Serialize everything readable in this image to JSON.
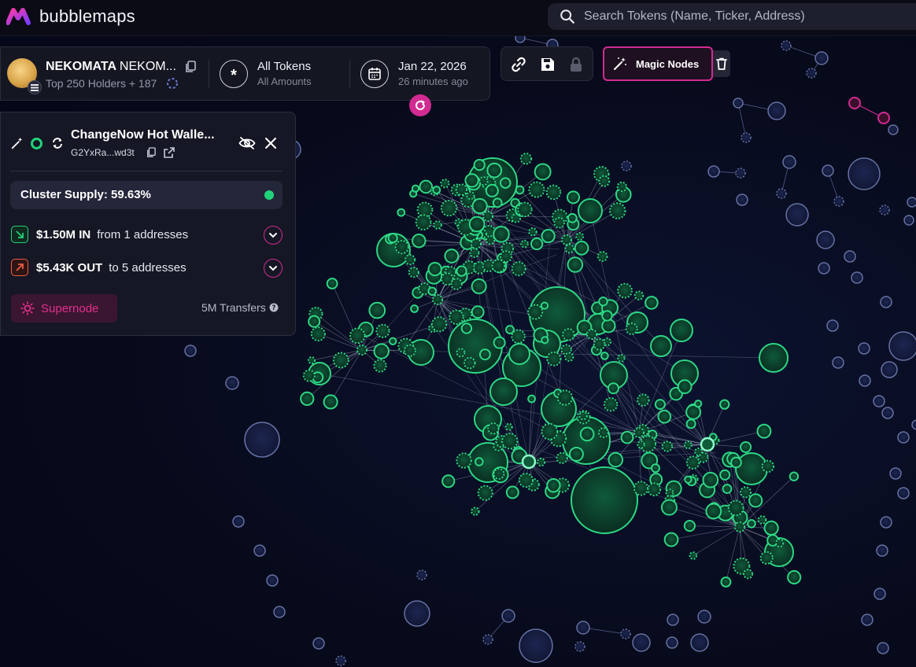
{
  "app": {
    "name": "bubblemaps"
  },
  "search": {
    "placeholder": "Search Tokens (Name, Ticker, Address)"
  },
  "token": {
    "name": "NEKOMATA",
    "ticker": "NEKOM...",
    "holders_label": "Top 250 Holders + 187"
  },
  "filter": {
    "title": "All Tokens",
    "subtitle": "All Amounts"
  },
  "date": {
    "title": "Jan 22, 2026",
    "subtitle": "26 minutes ago"
  },
  "toolbar": {
    "magic_nodes_label": "Magic Nodes"
  },
  "panel": {
    "title": "ChangeNow Hot Walle...",
    "address": "G2YxRa...wd3t",
    "cluster_supply": "Cluster Supply: 59.63%",
    "in_amount": "$1.50M IN",
    "in_rest": "from 1 addresses",
    "out_amount": "$5.43K OUT",
    "out_rest": "to 5 addresses",
    "supernode_label": "Supernode",
    "transfers": "5M Transfers"
  },
  "colors": {
    "accent": "#d12b91",
    "cluster": "#2fe08a",
    "bubble": "#8a9ad6",
    "background": "#070a1a"
  },
  "icons": [
    "search-icon",
    "copy-icon",
    "loading-icon",
    "asterisk-icon",
    "calendar-icon",
    "refresh-icon",
    "link-icon",
    "save-icon",
    "lock-icon",
    "magic-wand-icon",
    "trash-icon",
    "eye-off-icon",
    "close-icon",
    "sync-icon",
    "arrow-in-icon",
    "arrow-out-icon",
    "chevron-down-icon",
    "sun-icon",
    "help-icon"
  ]
}
